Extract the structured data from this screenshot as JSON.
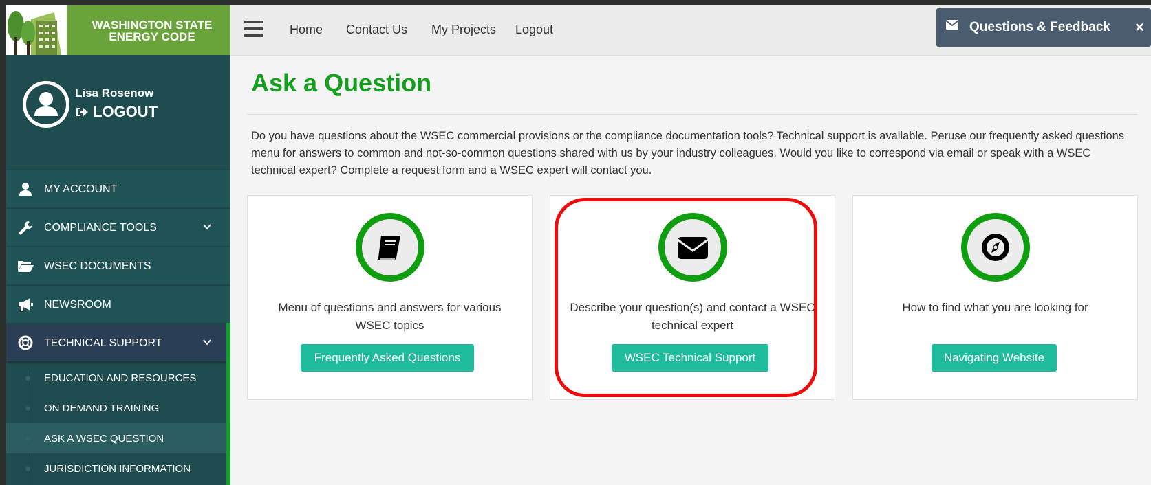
{
  "brand": {
    "line1": "WASHINGTON STATE",
    "line2": "ENERGY CODE"
  },
  "user": {
    "name": "Lisa Rosenow",
    "logout": "LOGOUT"
  },
  "sidebar": {
    "items": [
      {
        "label": "MY ACCOUNT",
        "icon": "user-icon"
      },
      {
        "label": "COMPLIANCE TOOLS",
        "icon": "wrench-icon"
      },
      {
        "label": "WSEC DOCUMENTS",
        "icon": "folder-open-icon"
      },
      {
        "label": "NEWSROOM",
        "icon": "megaphone-icon"
      },
      {
        "label": "TECHNICAL SUPPORT",
        "icon": "lifebuoy-icon"
      }
    ],
    "subitems": [
      {
        "label": "EDUCATION AND RESOURCES"
      },
      {
        "label": "ON DEMAND TRAINING"
      },
      {
        "label": "ASK A WSEC QUESTION"
      },
      {
        "label": "JURISDICTION INFORMATION"
      }
    ]
  },
  "topbar": {
    "links": [
      "Home",
      "Contact Us",
      "My Projects",
      "Logout"
    ],
    "feedback": "Questions & Feedback",
    "close": "×"
  },
  "main": {
    "title": "Ask a Question",
    "intro": "Do you have questions about the WSEC commercial provisions or the compliance documentation tools? Technical support is available. Peruse our frequently asked questions menu for answers to common and not-so-common questions shared with us by your industry colleagues. Would you like to correspond via email or speak with a WSEC technical expert? Complete a request form and a WSEC expert will contact you.",
    "cards": [
      {
        "icon": "book-icon",
        "desc": "Menu of questions and answers for various WSEC topics",
        "button": "Frequently Asked Questions"
      },
      {
        "icon": "envelope-icon",
        "desc": "Describe your question(s) and contact a WSEC technical expert",
        "button": "WSEC Technical Support"
      },
      {
        "icon": "compass-icon",
        "desc": "How to find what you are looking for",
        "button": "Navigating Website"
      }
    ]
  },
  "colors": {
    "accent_green": "#14a01e",
    "button_teal": "#1ebc9c",
    "sidebar": "#1f4d4f",
    "highlight_red": "#ee0b0b"
  }
}
